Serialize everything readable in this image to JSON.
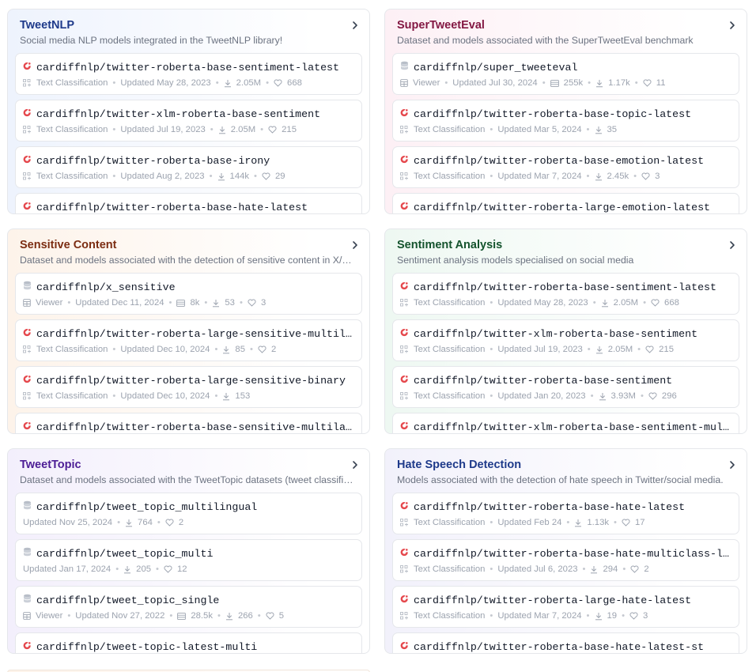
{
  "collections": [
    {
      "title": "TweetNLP",
      "title_color": "#1e3a8a",
      "theme": "c-blue",
      "description": "Social media NLP models integrated in the TweetNLP library!",
      "items": [
        {
          "kind": "model",
          "name": "cardiffnlp/twitter-roberta-base-sentiment-latest",
          "meta": [
            {
              "icon": "task-icon",
              "text": "Text Classification"
            },
            {
              "icon": "",
              "text": "Updated May 28, 2023"
            },
            {
              "icon": "download-icon",
              "text": "2.05M"
            },
            {
              "icon": "heart-icon",
              "text": "668"
            }
          ]
        },
        {
          "kind": "model",
          "name": "cardiffnlp/twitter-xlm-roberta-base-sentiment",
          "meta": [
            {
              "icon": "task-icon",
              "text": "Text Classification"
            },
            {
              "icon": "",
              "text": "Updated Jul 19, 2023"
            },
            {
              "icon": "download-icon",
              "text": "2.05M"
            },
            {
              "icon": "heart-icon",
              "text": "215"
            }
          ]
        },
        {
          "kind": "model",
          "name": "cardiffnlp/twitter-roberta-base-irony",
          "meta": [
            {
              "icon": "task-icon",
              "text": "Text Classification"
            },
            {
              "icon": "",
              "text": "Updated Aug 2, 2023"
            },
            {
              "icon": "download-icon",
              "text": "144k"
            },
            {
              "icon": "heart-icon",
              "text": "29"
            }
          ]
        },
        {
          "kind": "model",
          "name": "cardiffnlp/twitter-roberta-base-hate-latest",
          "meta": []
        }
      ]
    },
    {
      "title": "SuperTweetEval",
      "title_color": "#831843",
      "theme": "c-pink",
      "description": "Dataset and models associated with the SuperTweetEval benchmark",
      "items": [
        {
          "kind": "dataset",
          "name": "cardiffnlp/super_tweeteval",
          "meta": [
            {
              "icon": "viewer-icon",
              "text": "Viewer"
            },
            {
              "icon": "",
              "text": "Updated Jul 30, 2024"
            },
            {
              "icon": "rows-icon",
              "text": "255k"
            },
            {
              "icon": "download-icon",
              "text": "1.17k"
            },
            {
              "icon": "heart-icon",
              "text": "11"
            }
          ]
        },
        {
          "kind": "model",
          "name": "cardiffnlp/twitter-roberta-base-topic-latest",
          "meta": [
            {
              "icon": "task-icon",
              "text": "Text Classification"
            },
            {
              "icon": "",
              "text": "Updated Mar 5, 2024"
            },
            {
              "icon": "download-icon",
              "text": "35"
            }
          ]
        },
        {
          "kind": "model",
          "name": "cardiffnlp/twitter-roberta-base-emotion-latest",
          "meta": [
            {
              "icon": "task-icon",
              "text": "Text Classification"
            },
            {
              "icon": "",
              "text": "Updated Mar 7, 2024"
            },
            {
              "icon": "download-icon",
              "text": "2.45k"
            },
            {
              "icon": "heart-icon",
              "text": "3"
            }
          ]
        },
        {
          "kind": "model",
          "name": "cardiffnlp/twitter-roberta-large-emotion-latest",
          "meta": []
        }
      ]
    },
    {
      "title": "Sensitive Content",
      "title_color": "#7c2d12",
      "theme": "c-orange",
      "description": "Dataset and models associated with the detection of sensitive content in X/so…",
      "items": [
        {
          "kind": "dataset",
          "name": "cardiffnlp/x_sensitive",
          "meta": [
            {
              "icon": "viewer-icon",
              "text": "Viewer"
            },
            {
              "icon": "",
              "text": "Updated Dec 11, 2024"
            },
            {
              "icon": "rows-icon",
              "text": "8k"
            },
            {
              "icon": "download-icon",
              "text": "53"
            },
            {
              "icon": "heart-icon",
              "text": "3"
            }
          ]
        },
        {
          "kind": "model",
          "name": "cardiffnlp/twitter-roberta-large-sensitive-multilabel",
          "meta": [
            {
              "icon": "task-icon",
              "text": "Text Classification"
            },
            {
              "icon": "",
              "text": "Updated Dec 10, 2024"
            },
            {
              "icon": "download-icon",
              "text": "85"
            },
            {
              "icon": "heart-icon",
              "text": "2"
            }
          ]
        },
        {
          "kind": "model",
          "name": "cardiffnlp/twitter-roberta-large-sensitive-binary",
          "meta": [
            {
              "icon": "task-icon",
              "text": "Text Classification"
            },
            {
              "icon": "",
              "text": "Updated Dec 10, 2024"
            },
            {
              "icon": "download-icon",
              "text": "153"
            }
          ]
        },
        {
          "kind": "model",
          "name": "cardiffnlp/twitter-roberta-base-sensitive-multilabel",
          "meta": []
        }
      ]
    },
    {
      "title": "Sentiment Analysis",
      "title_color": "#14532d",
      "theme": "c-green",
      "description": "Sentiment analysis models specialised on social media",
      "items": [
        {
          "kind": "model",
          "name": "cardiffnlp/twitter-roberta-base-sentiment-latest",
          "meta": [
            {
              "icon": "task-icon",
              "text": "Text Classification"
            },
            {
              "icon": "",
              "text": "Updated May 28, 2023"
            },
            {
              "icon": "download-icon",
              "text": "2.05M"
            },
            {
              "icon": "heart-icon",
              "text": "668"
            }
          ]
        },
        {
          "kind": "model",
          "name": "cardiffnlp/twitter-xlm-roberta-base-sentiment",
          "meta": [
            {
              "icon": "task-icon",
              "text": "Text Classification"
            },
            {
              "icon": "",
              "text": "Updated Jul 19, 2023"
            },
            {
              "icon": "download-icon",
              "text": "2.05M"
            },
            {
              "icon": "heart-icon",
              "text": "215"
            }
          ]
        },
        {
          "kind": "model",
          "name": "cardiffnlp/twitter-roberta-base-sentiment",
          "meta": [
            {
              "icon": "task-icon",
              "text": "Text Classification"
            },
            {
              "icon": "",
              "text": "Updated Jan 20, 2023"
            },
            {
              "icon": "download-icon",
              "text": "3.93M"
            },
            {
              "icon": "heart-icon",
              "text": "296"
            }
          ]
        },
        {
          "kind": "model",
          "name": "cardiffnlp/twitter-xlm-roberta-base-sentiment-multil…",
          "meta": []
        }
      ]
    },
    {
      "title": "TweetTopic",
      "title_color": "#4c1d95",
      "theme": "c-purple",
      "description": "Dataset and models associated with the TweetTopic datasets (tweet classifica…",
      "items": [
        {
          "kind": "dataset",
          "name": "cardiffnlp/tweet_topic_multilingual",
          "meta": [
            {
              "icon": "",
              "text": "Updated Nov 25, 2024"
            },
            {
              "icon": "download-icon",
              "text": "764"
            },
            {
              "icon": "heart-icon",
              "text": "2"
            }
          ]
        },
        {
          "kind": "dataset",
          "name": "cardiffnlp/tweet_topic_multi",
          "meta": [
            {
              "icon": "",
              "text": "Updated Jan 17, 2024"
            },
            {
              "icon": "download-icon",
              "text": "205"
            },
            {
              "icon": "heart-icon",
              "text": "12"
            }
          ]
        },
        {
          "kind": "dataset",
          "name": "cardiffnlp/tweet_topic_single",
          "meta": [
            {
              "icon": "viewer-icon",
              "text": "Viewer"
            },
            {
              "icon": "",
              "text": "Updated Nov 27, 2022"
            },
            {
              "icon": "rows-icon",
              "text": "28.5k"
            },
            {
              "icon": "download-icon",
              "text": "266"
            },
            {
              "icon": "heart-icon",
              "text": "5"
            }
          ]
        },
        {
          "kind": "model",
          "name": "cardiffnlp/tweet-topic-latest-multi",
          "meta": []
        }
      ]
    },
    {
      "title": "Hate Speech Detection",
      "title_color": "#1e3a8a",
      "theme": "c-lav",
      "description": "Models associated with the detection of hate speech in Twitter/social media.",
      "items": [
        {
          "kind": "model",
          "name": "cardiffnlp/twitter-roberta-base-hate-latest",
          "meta": [
            {
              "icon": "task-icon",
              "text": "Text Classification"
            },
            {
              "icon": "",
              "text": "Updated Feb 24"
            },
            {
              "icon": "download-icon",
              "text": "1.13k"
            },
            {
              "icon": "heart-icon",
              "text": "17"
            }
          ]
        },
        {
          "kind": "model",
          "name": "cardiffnlp/twitter-roberta-base-hate-multiclass-late…",
          "meta": [
            {
              "icon": "task-icon",
              "text": "Text Classification"
            },
            {
              "icon": "",
              "text": "Updated Jul 6, 2023"
            },
            {
              "icon": "download-icon",
              "text": "294"
            },
            {
              "icon": "heart-icon",
              "text": "2"
            }
          ]
        },
        {
          "kind": "model",
          "name": "cardiffnlp/twitter-roberta-large-hate-latest",
          "meta": [
            {
              "icon": "task-icon",
              "text": "Text Classification"
            },
            {
              "icon": "",
              "text": "Updated Mar 7, 2024"
            },
            {
              "icon": "download-icon",
              "text": "19"
            },
            {
              "icon": "heart-icon",
              "text": "3"
            }
          ]
        },
        {
          "kind": "model",
          "name": "cardiffnlp/twitter-roberta-base-hate-latest-st",
          "meta": []
        }
      ]
    }
  ],
  "colors": {
    "model_icon": "#e5484d",
    "dataset_icon": "#b8bec8",
    "meta_text": "#9ca3af"
  }
}
